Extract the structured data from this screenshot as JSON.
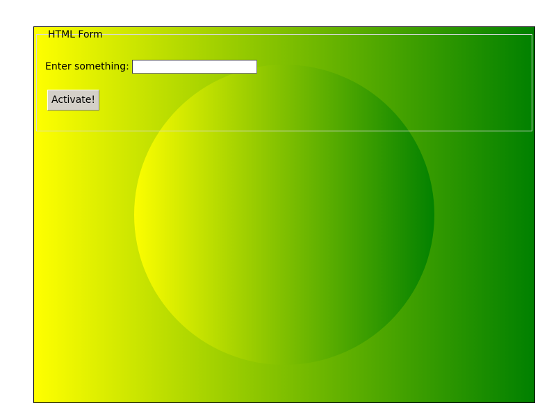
{
  "form": {
    "legend": "HTML Form",
    "input_label": "Enter something:",
    "input_value": "",
    "button_label": "Activate!"
  },
  "colors": {
    "gradient_start": "#ffff00",
    "gradient_end": "#008000",
    "frame_border": "#000000",
    "fieldset_border": "#d8d8d8",
    "button_face": "#d4d0c8"
  }
}
